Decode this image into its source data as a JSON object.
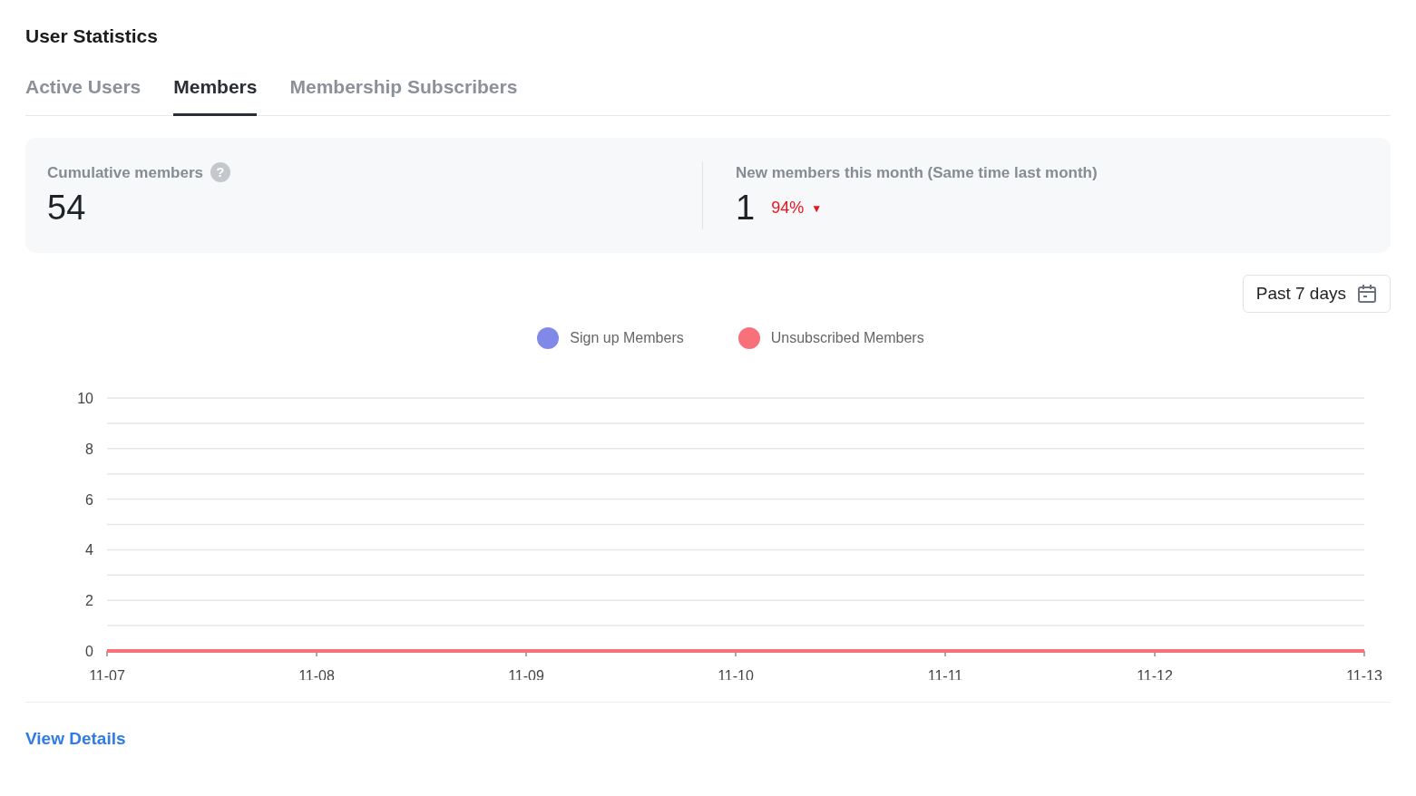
{
  "title": "User Statistics",
  "tabs": [
    {
      "label": "Active Users",
      "selected": false
    },
    {
      "label": "Members",
      "selected": true
    },
    {
      "label": "Membership Subscribers",
      "selected": false
    }
  ],
  "stats": [
    {
      "label": "Cumulative members",
      "help_icon": "?",
      "value": "54"
    },
    {
      "label": "New members this month (Same time last month)",
      "value": "1",
      "change": "94%",
      "change_icon": "▼"
    }
  ],
  "range_button": {
    "label": "Past 7 days"
  },
  "chart": {
    "chart_data": {
      "type": "line",
      "categories": [
        "11-07",
        "11-08",
        "11-09",
        "11-10",
        "11-11",
        "11-12",
        "11-13"
      ],
      "series": [
        {
          "name": "Sign up Members",
          "color": "#8088e8",
          "values": [
            null,
            null,
            null,
            null,
            null,
            null,
            null
          ]
        },
        {
          "name": "Unsubscribed Members",
          "color": "#f8707a",
          "values": [
            0,
            0,
            0,
            0,
            0,
            0,
            0
          ]
        }
      ],
      "ylim": [
        0,
        10
      ],
      "yticks": [
        0,
        2,
        4,
        6,
        8,
        10
      ],
      "grid": true
    }
  },
  "footer_link": "View Details"
}
